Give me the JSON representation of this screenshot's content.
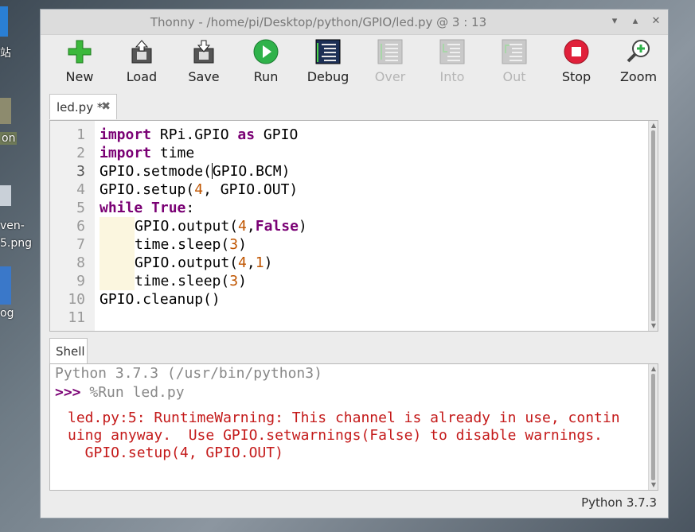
{
  "window": {
    "title": "Thonny  -  /home/pi/Desktop/python/GPIO/led.py  @  3 : 13"
  },
  "desktop_fragments": [
    "站",
    "on",
    "ven-",
    "5.png",
    "og"
  ],
  "toolbar": [
    {
      "label": "New",
      "icon": "new-icon",
      "enabled": true
    },
    {
      "label": "Load",
      "icon": "load-icon",
      "enabled": true
    },
    {
      "label": "Save",
      "icon": "save-icon",
      "enabled": true
    },
    {
      "label": "Run",
      "icon": "run-icon",
      "enabled": true
    },
    {
      "label": "Debug",
      "icon": "debug-icon",
      "enabled": true
    },
    {
      "label": "Over",
      "icon": "step-over-icon",
      "enabled": false
    },
    {
      "label": "Into",
      "icon": "step-into-icon",
      "enabled": false
    },
    {
      "label": "Out",
      "icon": "step-out-icon",
      "enabled": false
    },
    {
      "label": "Stop",
      "icon": "stop-icon",
      "enabled": true
    },
    {
      "label": "Zoom",
      "icon": "zoom-icon",
      "enabled": true
    }
  ],
  "editor": {
    "tab_label": "led.py *",
    "current_line": 3,
    "line_numbers": [
      "1",
      "2",
      "3",
      "4",
      "5",
      "6",
      "7",
      "8",
      "9",
      "10",
      "11"
    ],
    "code": [
      "import RPi.GPIO as GPIO",
      "import time",
      "GPIO.setmode(GPIO.BCM)",
      "GPIO.setup(4, GPIO.OUT)",
      "while True:",
      "    GPIO.output(4,False)",
      "    time.sleep(3)",
      "    GPIO.output(4,1)",
      "    time.sleep(3)",
      "GPIO.cleanup()",
      ""
    ]
  },
  "shell": {
    "tab_label": "Shell",
    "banner": "Python 3.7.3 (/usr/bin/python3)",
    "prompt": ">>>",
    "command": "%Run led.py",
    "error_lines": [
      "led.py:5: RuntimeWarning: This channel is already in use, contin",
      "uing anyway.  Use GPIO.setwarnings(False) to disable warnings.",
      "  GPIO.setup(4, GPIO.OUT)"
    ]
  },
  "status": {
    "interpreter": "Python 3.7.3"
  },
  "colors": {
    "keyword": "#7a0074",
    "number": "#c05500",
    "error": "#c41a1a",
    "indent_guide": "#fbf6df"
  }
}
